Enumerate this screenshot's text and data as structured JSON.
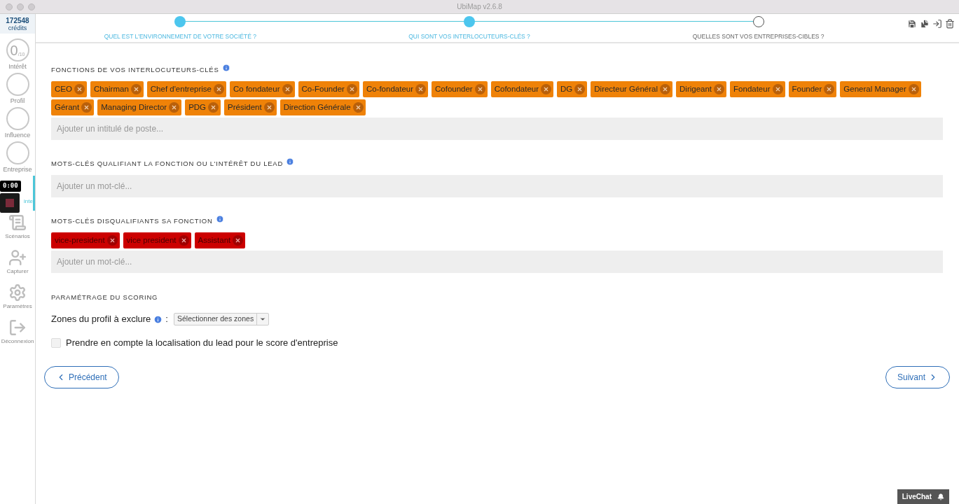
{
  "window": {
    "title": "UbiMap v2.6.8"
  },
  "sidebar": {
    "credits": {
      "value": "172548",
      "label": "crédits"
    },
    "items": [
      {
        "kind": "score",
        "value": "0",
        "max": "/10",
        "label": "Intérêt",
        "selected": false
      },
      {
        "kind": "score",
        "label": "Profil",
        "selected": false
      },
      {
        "kind": "score",
        "label": "Influence",
        "selected": false
      },
      {
        "kind": "score",
        "label": "Entreprise",
        "selected": false
      },
      {
        "kind": "fingerprint",
        "label": "inte",
        "selected": true
      },
      {
        "kind": "scroll",
        "label": "Scénarios",
        "selected": false
      },
      {
        "kind": "user-plus",
        "label": "Capturer",
        "selected": false
      },
      {
        "kind": "gear",
        "label": "Paramètres",
        "selected": false
      },
      {
        "kind": "logout",
        "label": "Déconnexion",
        "selected": false
      }
    ]
  },
  "recorder": {
    "time": "0:00"
  },
  "steps": [
    {
      "label": "QUEL EST L'ENVIRONNEMENT DE VOTRE SOCIÉTÉ ?",
      "done": true
    },
    {
      "label": "QUI SONT VOS INTERLOCUTEURS-CLÉS ?",
      "done": true
    },
    {
      "label": "QUELLES SONT VOS ENTREPRISES-CIBLES ?",
      "done": false
    }
  ],
  "sections": [
    {
      "title": "FONCTIONS DE VOS INTERLOCUTEURS-CLÉS",
      "info": true,
      "kind": "positive",
      "tags": [
        "CEO",
        "Chairman",
        "Chef d'entreprise",
        "Co fondateur",
        "Co-Founder",
        "Co-fondateur",
        "Cofounder",
        "Cofondateur",
        "DG",
        "Directeur Général",
        "Dirigeant",
        "Fondateur",
        "Founder",
        "General Manager",
        "Gérant",
        "Managing Director",
        "PDG",
        "Président",
        "Direction Générale"
      ],
      "placeholder": "Ajouter un intitulé de poste..."
    },
    {
      "title": "MOTS-CLÉS QUALIFIANT LA FONCTION OU L'INTÉRÊT DU LEAD",
      "info": true,
      "placeholder": "Ajouter un mot-clé..."
    },
    {
      "title": "MOTS-CLÉS DISQUALIFIANTS SA FONCTION",
      "info": true,
      "kind": "negative",
      "tags": [
        "vice-president",
        "vice president",
        "Assistant"
      ],
      "placeholder": "Ajouter un mot-clé..."
    }
  ],
  "scoring": {
    "title": "PARAMÉTRAGE DU SCORING",
    "zones_label": "Zones du profil à exclure",
    "colon": ":",
    "select": "Sélectionner des zones",
    "checkbox": {
      "label": "Prendre en compte la localisation du lead pour le score d'entreprise",
      "checked": false
    }
  },
  "buttons": {
    "previous": "Précédent",
    "next": "Suivant"
  },
  "livechat": "LiveChat"
}
